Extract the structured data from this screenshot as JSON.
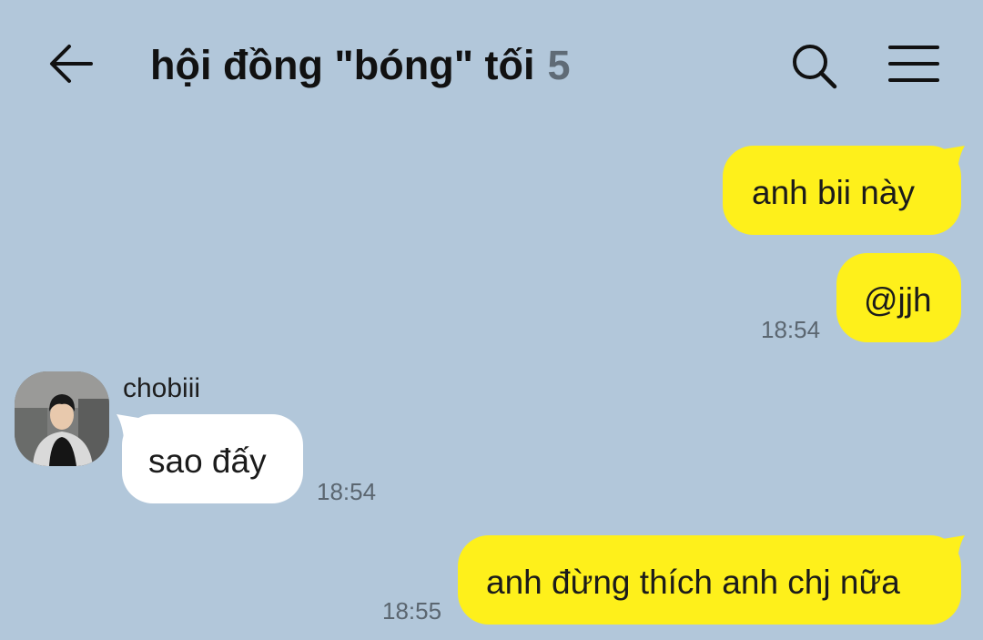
{
  "header": {
    "title": "hội đồng \"bóng\" tối",
    "member_count": "5",
    "back_icon": "arrow-left-icon",
    "search_icon": "search-icon",
    "menu_icon": "menu-icon"
  },
  "colors": {
    "background": "#b2c7da",
    "outgoing_bubble": "#fef01b",
    "incoming_bubble": "#ffffff",
    "timestamp": "#5b6670"
  },
  "messages": [
    {
      "direction": "outgoing",
      "text": "anh bii này",
      "time": ""
    },
    {
      "direction": "outgoing",
      "text": "@jjh",
      "time": "18:54"
    },
    {
      "direction": "incoming",
      "sender": "chobiii",
      "text": "sao đấy",
      "time": "18:54"
    },
    {
      "direction": "outgoing",
      "text": "anh đừng thích anh chj nữa",
      "time": "18:55"
    }
  ]
}
